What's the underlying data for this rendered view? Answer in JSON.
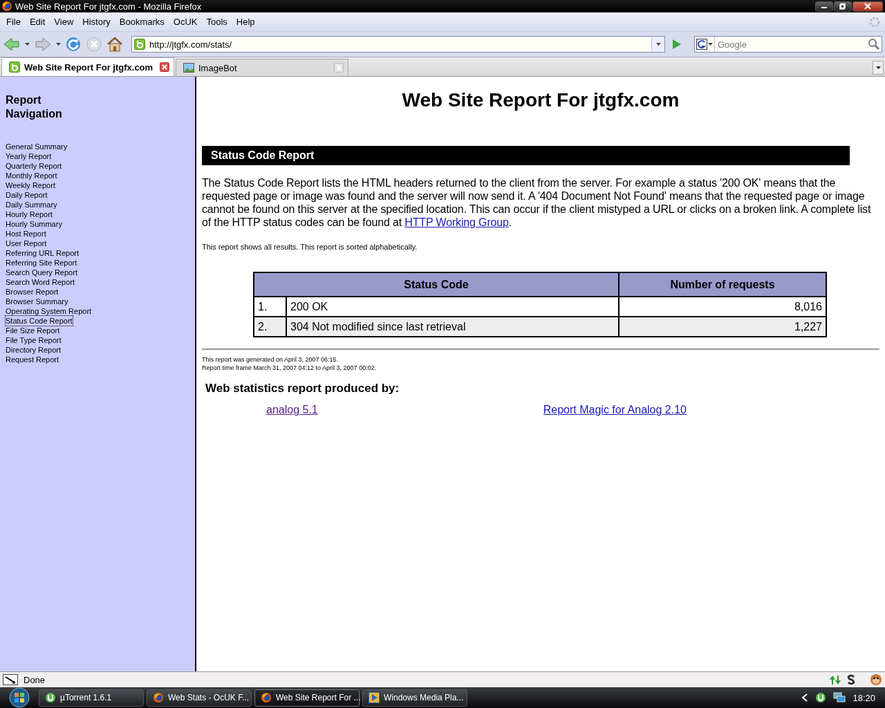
{
  "window": {
    "title": "Web Site Report For jtgfx.com - Mozilla Firefox"
  },
  "menu": [
    "File",
    "Edit",
    "View",
    "History",
    "Bookmarks",
    "OcUK",
    "Tools",
    "Help"
  ],
  "toolbar": {
    "url": "http://jtgfx.com/stats/",
    "search_placeholder": "Google"
  },
  "tabs": [
    {
      "label": "Web Site Report For jtgfx.com",
      "selected": true
    },
    {
      "label": "ImageBot",
      "selected": false
    }
  ],
  "sidebar": {
    "title": "Report Navigation",
    "items": [
      {
        "label": "General Summary",
        "selected": false
      },
      {
        "label": "Yearly Report",
        "selected": false
      },
      {
        "label": "Quarterly Report",
        "selected": false
      },
      {
        "label": "Monthly Report",
        "selected": false
      },
      {
        "label": "Weekly Report",
        "selected": false
      },
      {
        "label": "Daily Report",
        "selected": false
      },
      {
        "label": "Daily Summary",
        "selected": false
      },
      {
        "label": "Hourly Report",
        "selected": false
      },
      {
        "label": "Hourly Summary",
        "selected": false
      },
      {
        "label": "Host Report",
        "selected": false
      },
      {
        "label": "User Report",
        "selected": false
      },
      {
        "label": "Referring URL Report",
        "selected": false
      },
      {
        "label": "Referring Site Report",
        "selected": false
      },
      {
        "label": "Search Query Report",
        "selected": false
      },
      {
        "label": "Search Word Report",
        "selected": false
      },
      {
        "label": "Browser Report",
        "selected": false
      },
      {
        "label": "Browser Summary",
        "selected": false
      },
      {
        "label": "Operating System Report",
        "selected": false
      },
      {
        "label": "Status Code Report",
        "selected": true
      },
      {
        "label": "File Size Report",
        "selected": false
      },
      {
        "label": "File Type Report",
        "selected": false
      },
      {
        "label": "Directory Report",
        "selected": false
      },
      {
        "label": "Request Report",
        "selected": false
      }
    ]
  },
  "report": {
    "title": "Web Site Report For jtgfx.com",
    "section": "Status Code Report",
    "intro": {
      "text": "The Status Code Report lists the HTML headers returned to the client from the server. For example a status '200 OK' means that the requested page or image was found and the server will now send it. A '404 Document Not Found' means that the requested page or image cannot be found on this server at the specified location. This can occur if the client mistyped a URL or clicks on a broken link. A complete list of the HTTP status codes can be found at ",
      "link": "HTTP Working Group",
      "end": "."
    },
    "note": "This report shows all results. This report is sorted alphabetically.",
    "table": {
      "columns": [
        "Status Code",
        "Number of requests"
      ],
      "rows": [
        {
          "index": "1.",
          "code": "200 OK",
          "requests": "8,016"
        },
        {
          "index": "2.",
          "code": "304 Not modified since last retrieval",
          "requests": "1,227"
        }
      ]
    },
    "generated": "This report was generated on April 3, 2007 06:15.",
    "time_frame": "Report time frame March 31, 2007 04:12 to April 3, 2007 00:02.",
    "produced_by": "Web statistics report produced by:",
    "credits": [
      "analog 5.1",
      "Report Magic for Analog 2.10"
    ]
  },
  "status_bar": {
    "text": "Done"
  },
  "taskbar": {
    "buttons": [
      {
        "label": "µTorrent 1.6.1",
        "selected": false,
        "kind": "torrent"
      },
      {
        "label": "Web Stats - OcUK F...",
        "selected": false,
        "kind": "browser"
      },
      {
        "label": "Web Site Report For ...",
        "selected": true,
        "kind": "browser"
      },
      {
        "label": "Windows Media Pla...",
        "selected": false,
        "kind": "media"
      }
    ],
    "clock": "18:20"
  }
}
